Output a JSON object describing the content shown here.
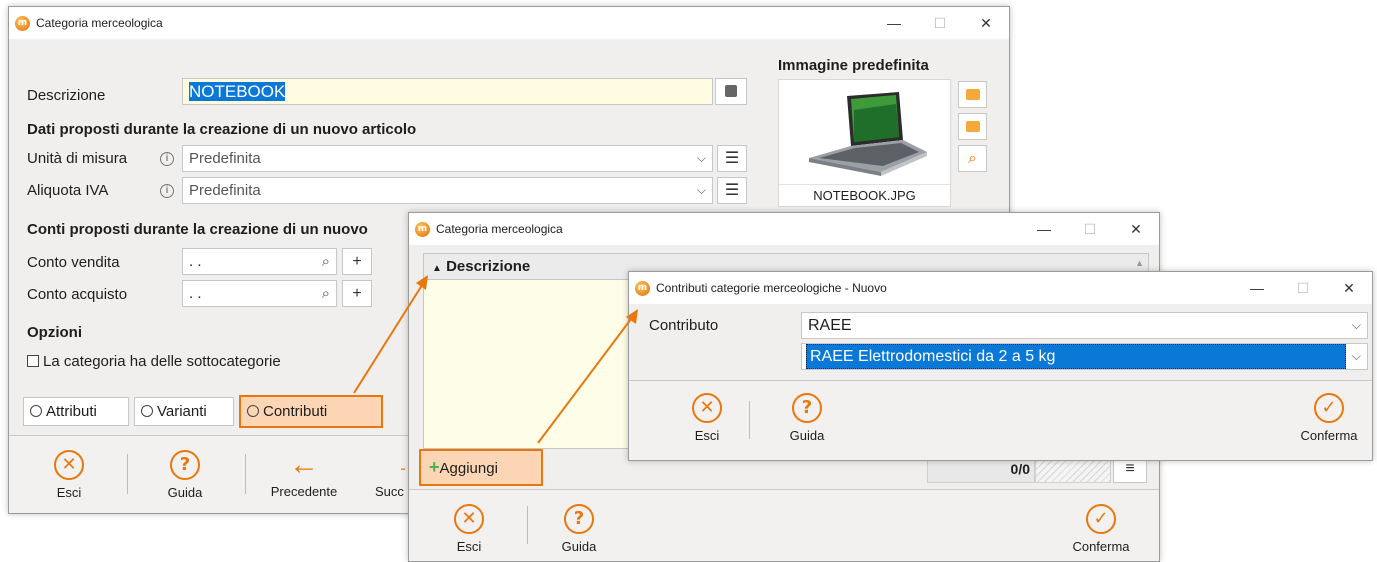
{
  "win1": {
    "title": "Categoria merceologica",
    "descrizione_label": "Descrizione",
    "descrizione_value": "NOTEBOOK",
    "dati_section": "Dati proposti durante la creazione di un nuovo articolo",
    "unita_label": "Unità di misura",
    "unita_value": "Predefinita",
    "aliquota_label": "Aliquota IVA",
    "aliquota_value": "Predefinita",
    "conti_section": "Conti proposti durante la creazione di un nuovo",
    "conto_vendita_label": "Conto vendita",
    "conto_vendita_value": ". .",
    "conto_acquisto_label": "Conto acquisto",
    "conto_acquisto_value": ". .",
    "opzioni_section": "Opzioni",
    "sottocategorie_label": "La categoria ha delle sottocategorie",
    "tabs": [
      "Attributi",
      "Varianti",
      "Contributi"
    ],
    "immagine_title": "Immagine predefinita",
    "image_filename": "NOTEBOOK.JPG",
    "toolbar": {
      "esci": "Esci",
      "guida": "Guida",
      "precedente": "Precedente",
      "successivo": "Succ"
    }
  },
  "win2": {
    "title": "Categoria merceologica",
    "column_header": "Descrizione",
    "aggiungi": "Aggiungi",
    "counter": "0/0",
    "toolbar": {
      "esci": "Esci",
      "guida": "Guida",
      "conferma": "Conferma"
    }
  },
  "win3": {
    "title": "Contributi categorie merceologiche - Nuovo",
    "contributo_label": "Contributo",
    "contributo_value": "RAEE",
    "sub_value": "RAEE Elettrodomestici da 2 a 5 kg",
    "toolbar": {
      "esci": "Esci",
      "guida": "Guida",
      "conferma": "Conferma"
    }
  },
  "colors": {
    "accent": "#e8770e",
    "highlight": "#fbd5b4",
    "selection": "#0a78d7",
    "list_bg": "#fdfde8"
  }
}
